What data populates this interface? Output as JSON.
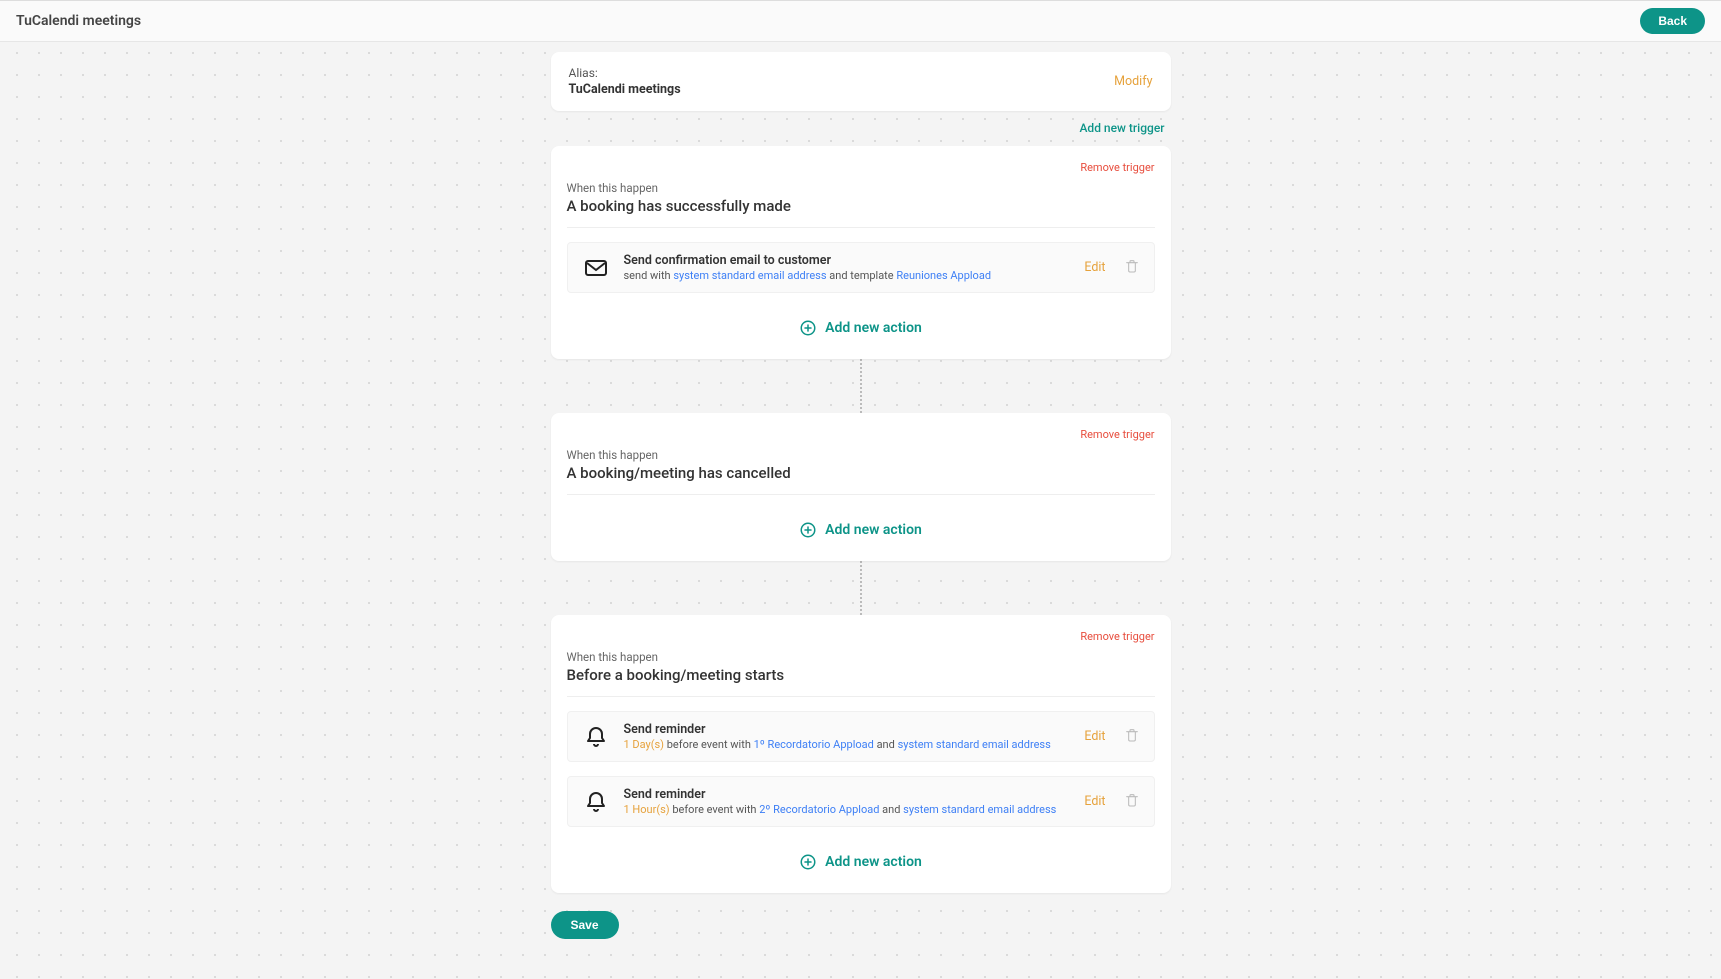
{
  "header": {
    "title": "TuCalendi meetings",
    "back_label": "Back"
  },
  "alias": {
    "label": "Alias:",
    "value": "TuCalendi meetings",
    "modify_label": "Modify"
  },
  "labels": {
    "add_new_trigger": "Add new trigger",
    "remove_trigger": "Remove trigger",
    "when_this_happen": "When this happen",
    "add_new_action": "Add new action",
    "edit": "Edit",
    "save": "Save",
    "send_with": "send with ",
    "and_template": " and template ",
    "before_event_with": " before event with ",
    "and": " and "
  },
  "triggers": [
    {
      "title": "A booking has successfully made",
      "actions": [
        {
          "icon": "envelope",
          "title": "Send confirmation email to customer",
          "parts": {
            "prefix_key": "send_with",
            "link1": "system standard email address",
            "mid_key": "and_template",
            "link2": "Reuniones Appload"
          }
        }
      ]
    },
    {
      "title": "A booking/meeting has cancelled",
      "actions": []
    },
    {
      "title": "Before a booking/meeting starts",
      "actions": [
        {
          "icon": "bell",
          "title": "Send reminder",
          "parts": {
            "duration": "1 Day(s)",
            "prefix_key": "before_event_with",
            "link1": "1º Recordatorio Appload",
            "mid_key": "and",
            "link2": "system standard email address"
          }
        },
        {
          "icon": "bell",
          "title": "Send reminder",
          "parts": {
            "duration": "1 Hour(s)",
            "prefix_key": "before_event_with",
            "link1": "2º Recordatorio Appload",
            "mid_key": "and",
            "link2": "system standard email address"
          }
        }
      ]
    }
  ]
}
